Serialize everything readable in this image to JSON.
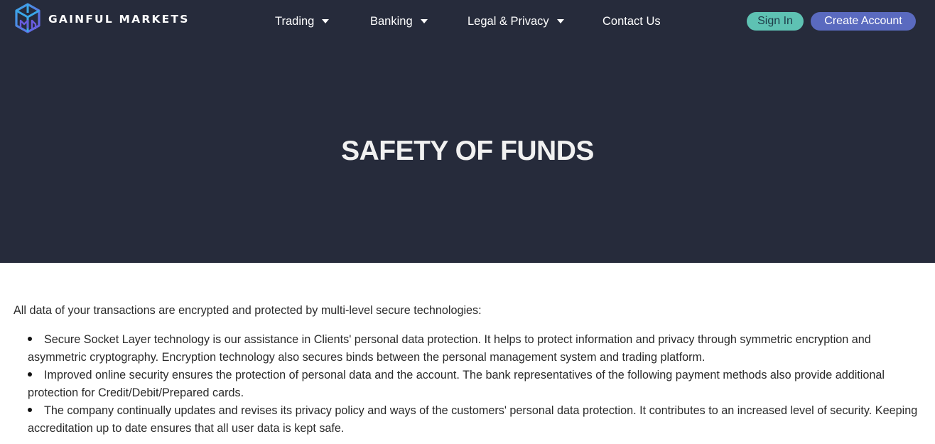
{
  "brand": {
    "name": "GAINFUL MARKETS",
    "logo_icon": "cube-logo-icon",
    "colors": {
      "logo_primary": "#3aa8e8",
      "logo_secondary": "#6a5be0"
    }
  },
  "nav": {
    "items": [
      {
        "label": "Trading",
        "has_dropdown": true
      },
      {
        "label": "Banking",
        "has_dropdown": true
      },
      {
        "label": "Legal & Privacy",
        "has_dropdown": true
      },
      {
        "label": "Contact Us",
        "has_dropdown": false
      }
    ],
    "sign_in": "Sign In",
    "create_account": "Create Account"
  },
  "hero": {
    "title": "SAFETY OF FUNDS"
  },
  "content": {
    "intro": "All data of your transactions are encrypted and protected by multi-level secure technologies:",
    "bullets": [
      "Secure Socket Layer technology is our assistance in Clients' personal data protection. It helps to protect information and privacy through symmetric encryption and asymmetric cryptography. Encryption technology also secures binds between the personal management system and trading platform.",
      "Improved online security ensures the protection of personal data and the account. The bank representatives of the following payment methods also provide additional protection for Credit/Debit/Prepared cards.",
      "The company continually updates and revises its privacy policy and ways of the customers' personal data protection. It contributes to an increased level of security. Keeping accreditation up to date ensures that all user data is kept safe."
    ]
  },
  "colors": {
    "hero_background": "#262b3b",
    "sign_in_button": "#5ec2b3",
    "create_account_button": "#5a6abf"
  }
}
